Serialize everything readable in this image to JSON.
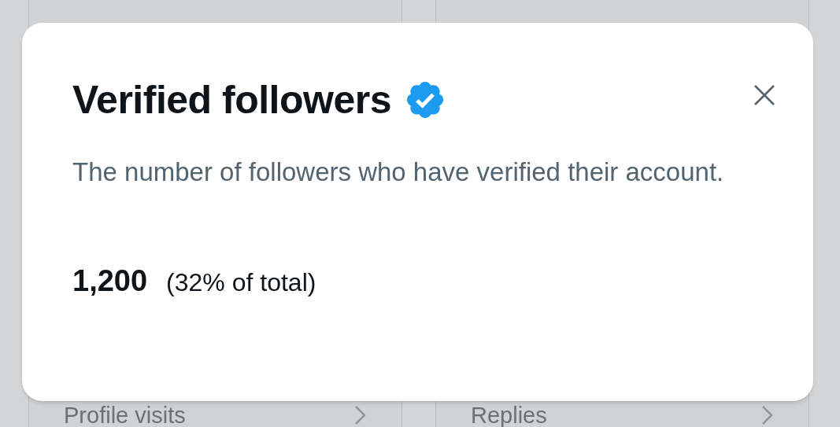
{
  "dialog": {
    "title": "Verified followers",
    "description": "The number of followers who have verified their account.",
    "count": "1,200",
    "share": "(32% of total)"
  },
  "background_cards": [
    {
      "label": "Profile visits"
    },
    {
      "label": "Replies"
    }
  ]
}
